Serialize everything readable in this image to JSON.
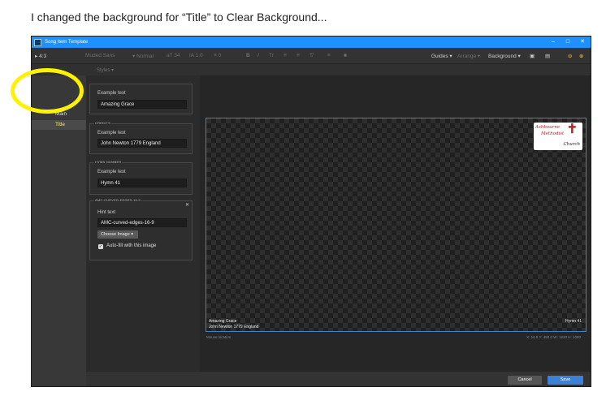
{
  "caption": "I changed the background for “Title” to Clear Background...",
  "window": {
    "title": "Song Item Template",
    "controls": {
      "minimize": "–",
      "maximize": "□",
      "close": "✕"
    }
  },
  "toolbar": {
    "aspect": "▸ 4:3",
    "font": "Muded Sans",
    "style": "▾ Normal",
    "size": "34",
    "line_height": "1.0",
    "spacing": "0",
    "guides": "Guides ▾",
    "arrange": "Arrange ▾",
    "background": "Background ▾"
  },
  "subbar": {
    "styles": "Styles ▾"
  },
  "nav": {
    "items": [
      {
        "label": "Main"
      },
      {
        "label": "Title"
      }
    ]
  },
  "groups": {
    "title": {
      "label_text": "Example text",
      "value": "Amazing Grace"
    },
    "credits": {
      "header": "CREDITS",
      "label_text": "Example text",
      "value": "John Newton 1779 England"
    },
    "hymn": {
      "header": "HYMN NUMBER",
      "label_text": "Example text",
      "value": "Hymn 41"
    },
    "image": {
      "header": "AMC-CURVED-EDGES-16-9",
      "hint_label": "Hint text",
      "hint_value": "AMC-curved-edges-16-9",
      "choose_button": "Choose Image ▾",
      "autofill_label": "Auto-fill with this image"
    }
  },
  "canvas": {
    "logo": {
      "line1": "Ashbourne",
      "line2": "Methodist",
      "line3": "Church"
    },
    "title_text": "Amazing Grace",
    "credits_text": "John Newton 1779 England",
    "hymn_text": "Hymn 41",
    "mouse_location": "Mouse location",
    "coords": "X: 16.5  Y: 480.0   W: 1920  H: 1080"
  },
  "footer": {
    "cancel": "Cancel",
    "save": "Save"
  },
  "colors": {
    "accent": "#1e90ff",
    "highlight": "#fff200",
    "save": "#3b82d6"
  }
}
